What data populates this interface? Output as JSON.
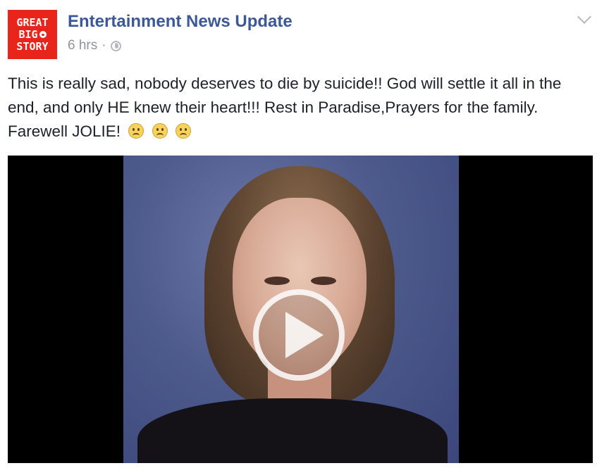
{
  "page": {
    "logo_lines": [
      "GREAT",
      "BIG",
      "STORY"
    ],
    "name": "Entertainment News Update",
    "time": "6 hrs",
    "separator": "·",
    "privacy_icon": "globe-icon",
    "menu_icon": "chevron-down-icon"
  },
  "post": {
    "text": "This is really sad, nobody deserves to die by suicide!! God will settle it all in the end, and only HE knew their heart!!! Rest in Paradise,Prayers for the family. Farewell JOLIE!",
    "emojis": [
      "sad-face-emoji",
      "sad-face-emoji",
      "sad-face-emoji"
    ]
  },
  "video": {
    "play_icon": "play-button-icon"
  },
  "colors": {
    "logo_red": "#e8241b",
    "link_blue": "#3b5998",
    "meta_gray": "#90949c",
    "text": "#1d2129"
  }
}
